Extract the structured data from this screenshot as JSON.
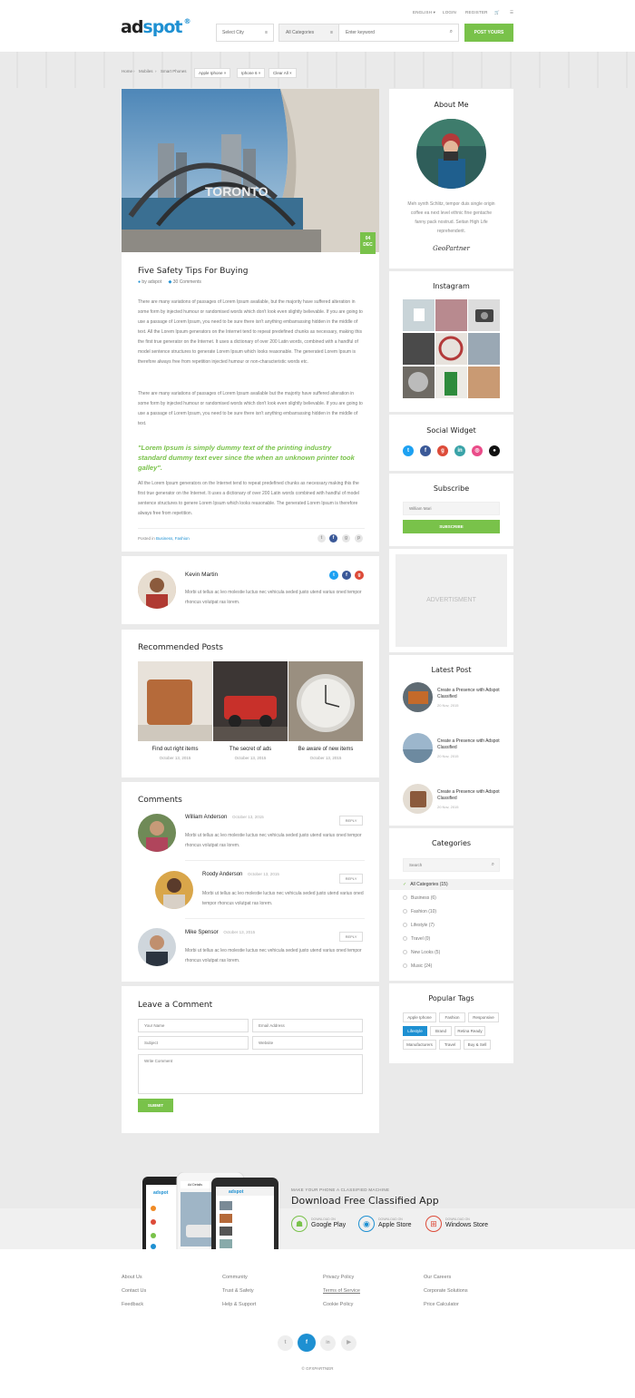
{
  "header": {
    "logo_a": "ad",
    "logo_b": "spot",
    "lang": "ENGLISH ▾",
    "login": "LOGIN",
    "register": "REGISTER",
    "city_placeholder": "Select City",
    "category": "All Categories",
    "keyword_placeholder": "Enter keyword",
    "post_button": "POST YOURS"
  },
  "breadcrumb": {
    "items": [
      "Home",
      "Mobiles",
      "Smart Phones"
    ],
    "chips": [
      "Apple Iphone",
      "Iphone 6",
      "Clear All"
    ]
  },
  "post": {
    "date_day": "04",
    "date_month": "DEC",
    "title": "Five Safety Tips For Buying",
    "author": "by adspot",
    "comments": "30 Comments",
    "paragraph_1": "There are many variations of passages of Lorem Ipsum available, but the majority have suffered alteration in some form by injected humour or randomised words which don't look even slightly believable. If you are going to use a passage of Lorem Ipsum, you need to be sure there isn't anything embarrassing hidden in the middle of text. All the Lorem Ipsum generators on the Internet tend to repeat predefined chunks as necessary, making this the first true generator on the Internet. It uses a dictionary of over 200 Latin words, combined with a handful of model sentence structures to generate Lorem Ipsum which looks reasonable. The generated Lorem Ipsum is therefore always free from repetition injected humour or non-characteristic words etc.",
    "paragraph_2": "There are many variations of passages of Lorem Ipsum available but the majority have suffered alteration in some form by injected humour or randomised words which don't look even slightly believable. If you are going to use a passage of Lorem Ipsum, you need to be sure there isn't anything embarrassing hidden in the middle of text.",
    "quote": "\"Lorem Ipsum is simply dummy text of the printing industry standard dummy text ever since the when an unknown printer took galley\".",
    "paragraph_3": "All the Lorem Ipsum generators on the Internet tend to repeat predefined chunks as necessary making this the first true generator on the Internet. It uses a dictionary of over 200 Latin words combined with handful of model sentence structures to genere Lorem Ipsum which looks reasonable. The generated Lorem Ipsum is therefore always free from repetition.",
    "posted_in": "Posted in",
    "posted_tags": "Business, Fashion"
  },
  "author_box": {
    "name": "Kevin Martin",
    "bio": "Morbi ut tellus ac leo molestie luctus nec vehicula seded justo utend varius oned tempor rhoncus volutpat ras lorem."
  },
  "recommended": {
    "title": "Recommended Posts",
    "items": [
      {
        "title": "Find out right items",
        "date": "October 13, 2015"
      },
      {
        "title": "The secret of ads",
        "date": "October 13, 2015"
      },
      {
        "title": "Be aware of new items",
        "date": "October 13, 2015"
      }
    ]
  },
  "comments": {
    "title": "Comments",
    "reply": "REPLY",
    "items": [
      {
        "name": "William Anderson",
        "date": "October 13, 2015",
        "text": "Morbi ut tellus ac leo molestie luctus nec vehicula seded justo utend varius oned tempor rhoncus volutpat ras lorem."
      },
      {
        "name": "Roody Anderson",
        "date": "October 13, 2015",
        "text": "Morbi ut tellus ac leo molestie luctus nec vehicula seded justo utend varius oned tempor rhoncus volutpat ras lorem."
      },
      {
        "name": "Mike Spensor",
        "date": "October 13, 2015",
        "text": "Morbi ut tellus ac leo molestie luctus nec vehicula seded justo utend varius oned tempor rhoncus volutpat ras lorem."
      }
    ]
  },
  "leave_comment": {
    "title": "Leave a Comment",
    "name_placeholder": "Your Name",
    "email_placeholder": "Email Address",
    "subject_placeholder": "Subject",
    "website_placeholder": "Website",
    "comment_placeholder": "Write Comment",
    "submit": "SUBMIT"
  },
  "sidebar": {
    "about_title": "About Me",
    "about_text": "Meh synth Schlitz, tempor duis single origin coffee ea next level ethnic fine gentache fanny pack nostrud. Seitan High Life reprehenderit.",
    "signature": "GeoPartner",
    "instagram_title": "Instagram",
    "social_title": "Social Widget",
    "subscribe_title": "Subscribe",
    "subscribe_placeholder": "William Mari",
    "subscribe_button": "SUBSCRIBE",
    "advert": "ADVERTISMENT",
    "latest_title": "Latest Post",
    "latest": [
      {
        "title": "Create a Presence with Adspot Classified",
        "date": "20 Nov, 2015"
      },
      {
        "title": "Create a Presence with Adspot Classified",
        "date": "20 Nov, 2015"
      },
      {
        "title": "Create a Presence with Adspot Classified",
        "date": "20 Nov, 2015"
      }
    ],
    "categories_title": "Categories",
    "categories_search": "Search",
    "categories": [
      {
        "label": "All Categories",
        "count": "(15)"
      },
      {
        "label": "Business",
        "count": "(6)"
      },
      {
        "label": "Fashion",
        "count": "(10)"
      },
      {
        "label": "Lifestyle",
        "count": "(7)"
      },
      {
        "label": "Travel",
        "count": "(0)"
      },
      {
        "label": "New Looks",
        "count": "(5)"
      },
      {
        "label": "Music",
        "count": "(24)"
      }
    ],
    "tags_title": "Popular Tags",
    "tags": [
      "Apple Iphone",
      "Fashion",
      "Responsive",
      "Lifestyle",
      "Brand",
      "Retina Ready",
      "Manufacturers",
      "Travel",
      "Buy & Sell"
    ]
  },
  "app": {
    "kicker": "MAKE YOUR PHONE A CLASSIFIED MACHINE",
    "title": "Download Free Classified App",
    "stores": [
      {
        "small": "DOWNLOAD ON",
        "name": "Google Play"
      },
      {
        "small": "DOWNLOAD ON",
        "name": "Apple Store"
      },
      {
        "small": "DOWNLOAD ON",
        "name": "Windows Store"
      }
    ],
    "phone_logo": "adspot",
    "phone_header": "Ad Details"
  },
  "footer": {
    "col1": [
      "About Us",
      "Contact Us",
      "Feedback"
    ],
    "col2": [
      "Community",
      "Trust & Safety",
      "Help & Support"
    ],
    "col3": [
      "Privacy Policy",
      "Terms of Service",
      "Cookie Policy"
    ],
    "col4": [
      "Our Careers",
      "Corporate Solutions",
      "Price Calculator"
    ],
    "copyright": "© GFXPARTNER"
  },
  "colors": {
    "accent_green": "#79c24a",
    "accent_blue": "#1e90d2"
  }
}
